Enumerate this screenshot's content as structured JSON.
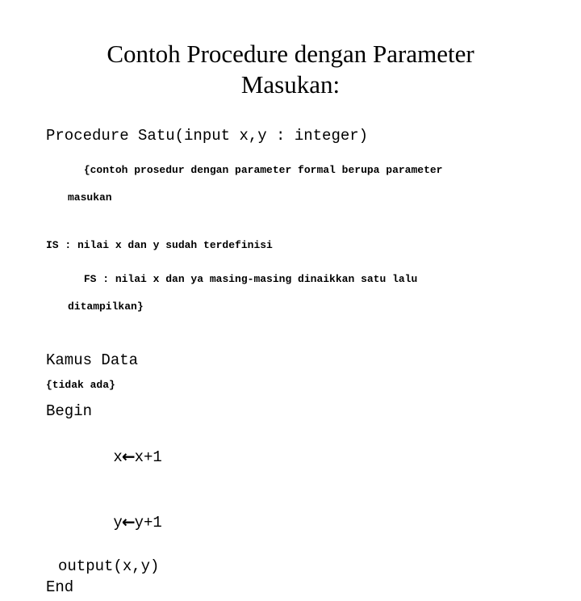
{
  "slide": {
    "background_color": "#ffffff",
    "text_color": "#000000",
    "title": {
      "line1": "Contoh Procedure dengan Parameter",
      "line2": "Masukan:"
    },
    "body": {
      "signature": "Procedure Satu(input x,y : integer)",
      "spec_comment": {
        "line1": "{contoh prosedur dengan parameter formal berupa parameter",
        "line2": "masukan"
      },
      "initial_state": "IS : nilai x dan y sudah terdefinisi",
      "final_state": {
        "line1": "FS : nilai x dan ya masing-masing dinaikkan satu lalu",
        "line2": "ditampilkan}"
      },
      "dictionary_heading": "Kamus Data",
      "dictionary_content": "{tidak ada}",
      "begin_keyword": "Begin",
      "statements": [
        {
          "target": "x",
          "arrow": "←",
          "expression": "x+1"
        },
        {
          "target": "y",
          "arrow": "←",
          "expression": "y+1"
        }
      ],
      "output_statement": "output(x,y)",
      "end_keyword": "End"
    }
  }
}
